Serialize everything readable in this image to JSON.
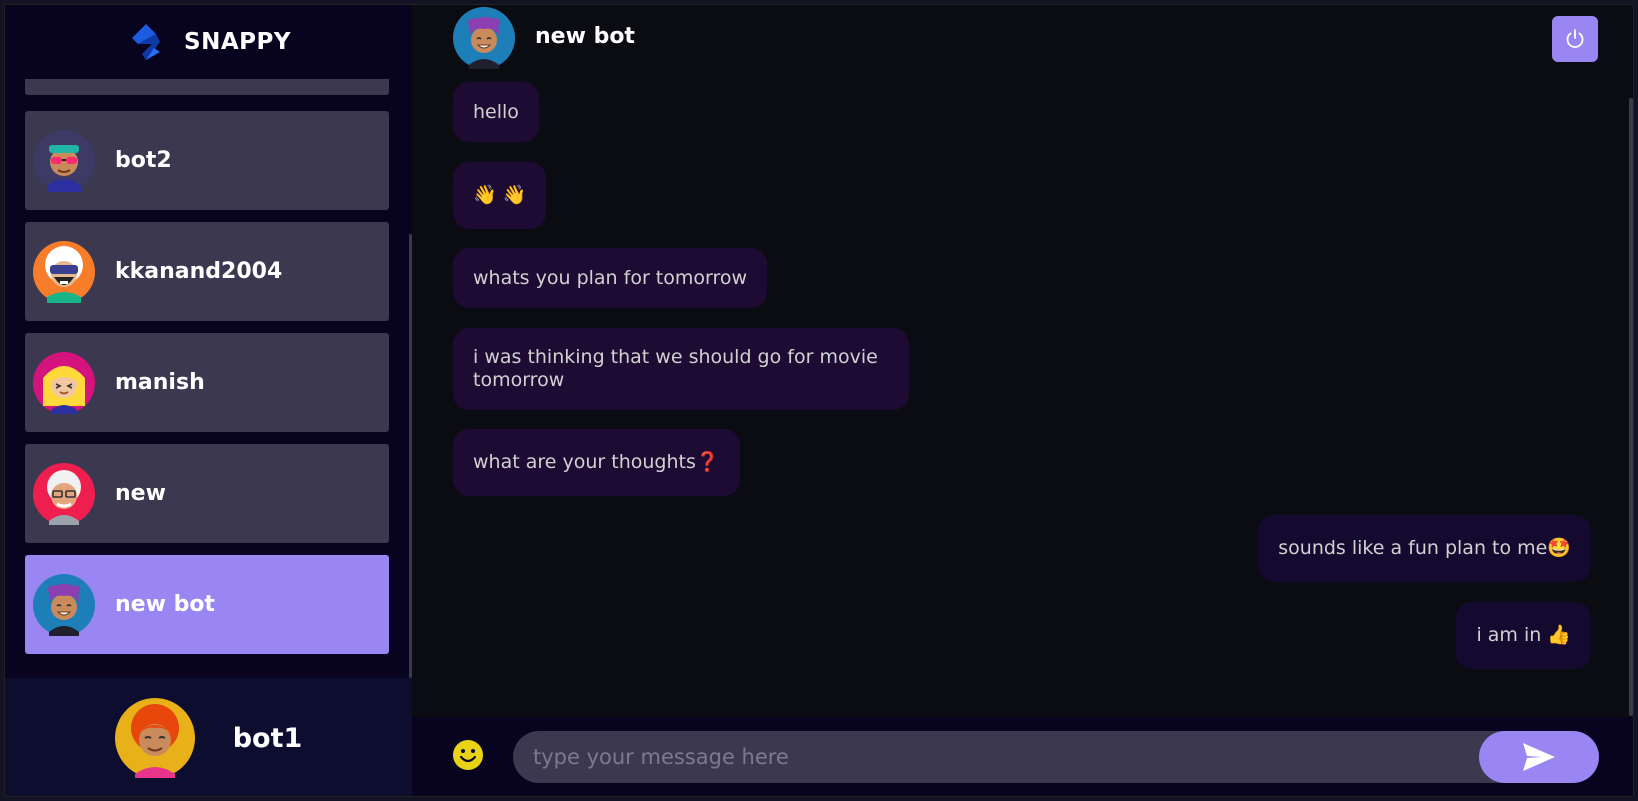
{
  "brand": {
    "name": "SNAPPY",
    "logo_icon": "snappy-logo-icon"
  },
  "contacts": [
    {
      "name": "bot2",
      "avatar": "avatar-sunglasses-icon",
      "active": false
    },
    {
      "name": "kkanand2004",
      "avatar": "avatar-white-hair-goggles-icon",
      "active": false
    },
    {
      "name": "manish",
      "avatar": "avatar-blonde-icon",
      "active": false
    },
    {
      "name": "new",
      "avatar": "avatar-white-hair-glasses-icon",
      "active": false
    },
    {
      "name": "new bot",
      "avatar": "avatar-purple-hair-icon",
      "active": true
    }
  ],
  "current_user": {
    "name": "bot1",
    "avatar": "avatar-orange-hair-icon"
  },
  "chat": {
    "title": "new bot",
    "avatar": "avatar-purple-hair-icon",
    "logout_icon": "power-icon",
    "messages": [
      {
        "text": "hello",
        "side": "received"
      },
      {
        "text": "👋 👋",
        "side": "received"
      },
      {
        "text": "whats you plan for tomorrow",
        "side": "received"
      },
      {
        "text": "i was thinking that we should go for movie tomorrow",
        "side": "received"
      },
      {
        "text": "what are your thoughts❓",
        "side": "received"
      },
      {
        "text": "sounds like a fun plan to me🤩",
        "side": "sent"
      },
      {
        "text": "i am in 👍",
        "side": "sent"
      }
    ]
  },
  "input": {
    "placeholder": "type your message here",
    "value": "",
    "emoji_icon": "smiley-icon",
    "send_icon": "send-icon"
  },
  "colors": {
    "accent": "#9a86f3",
    "sidebar_bg": "#080420",
    "contact_bg": "#3c3850",
    "chat_bg": "#0b0b12",
    "bubble_received": "#1d0b33",
    "bubble_sent": "#140a30"
  }
}
